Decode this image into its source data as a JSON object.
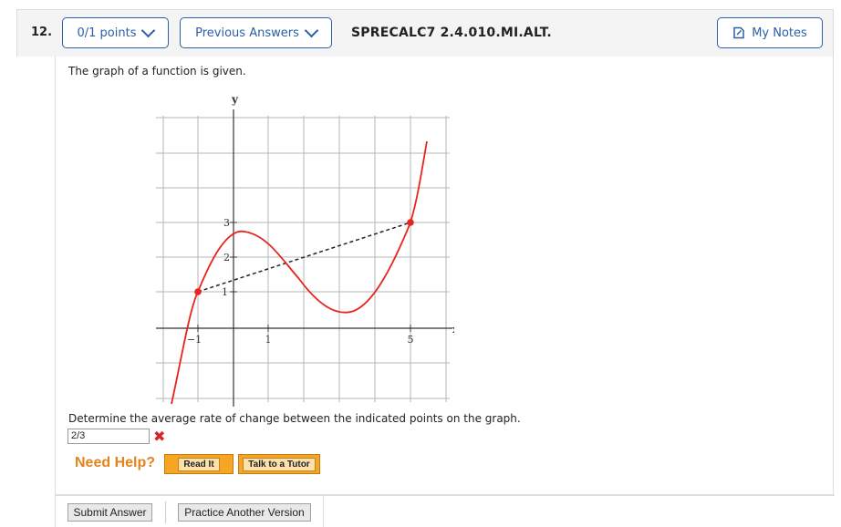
{
  "question": {
    "number": "12.",
    "points_label": "0/1 points",
    "previous_answers_label": "Previous Answers",
    "code": "SPRECALC7 2.4.010.MI.ALT.",
    "my_notes_label": "My Notes"
  },
  "prompt": "The graph of a function is given.",
  "graph": {
    "x_axis_label": "x",
    "y_axis_label": "y",
    "x_tick_labels": [
      "−1",
      "1",
      "5"
    ],
    "y_tick_labels": [
      "1",
      "2",
      "3"
    ],
    "curve_color": "#e8241d",
    "points": [
      {
        "x": -1,
        "y": 1
      },
      {
        "x": 5,
        "y": 3
      }
    ],
    "line_style": "dashed"
  },
  "determine_text": "Determine the average rate of change between the indicated points on the graph.",
  "answer": {
    "value": "2/3",
    "status": "incorrect"
  },
  "help": {
    "label": "Need Help?",
    "read_it": "Read It",
    "talk_to_tutor": "Talk to a Tutor"
  },
  "actions": {
    "submit": "Submit Answer",
    "practice": "Practice Another Version"
  },
  "colors": {
    "accent": "#2b5fa7",
    "help": "#e5821e",
    "error": "#d32626"
  }
}
